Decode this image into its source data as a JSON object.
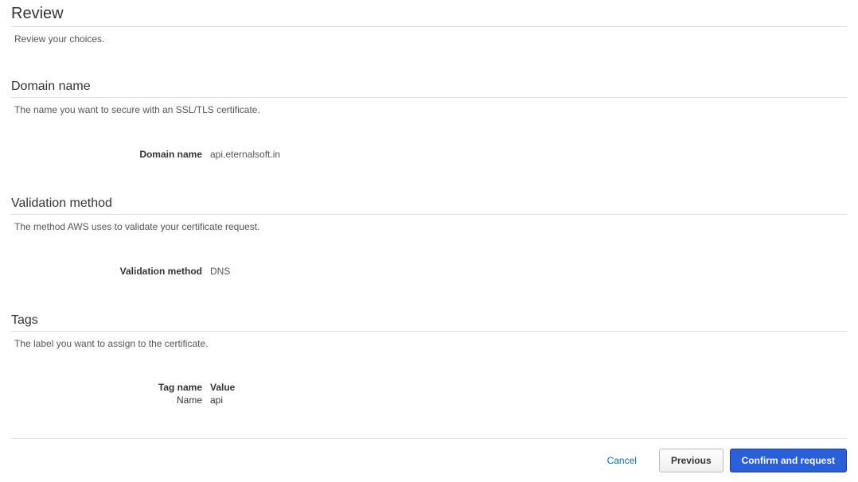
{
  "review": {
    "title": "Review",
    "desc": "Review your choices."
  },
  "domain": {
    "title": "Domain name",
    "desc": "The name you want to secure with an SSL/TLS certificate.",
    "label": "Domain name",
    "value": "api.eternalsoft.in"
  },
  "validation": {
    "title": "Validation method",
    "desc": "The method AWS uses to validate your certificate request.",
    "label": "Validation method",
    "value": "DNS"
  },
  "tags": {
    "title": "Tags",
    "desc": "The label you want to assign to the certificate.",
    "header_name": "Tag name",
    "header_value": "Value",
    "row_name": "Name",
    "row_value": "api"
  },
  "footer": {
    "cancel": "Cancel",
    "previous": "Previous",
    "confirm": "Confirm and request"
  }
}
